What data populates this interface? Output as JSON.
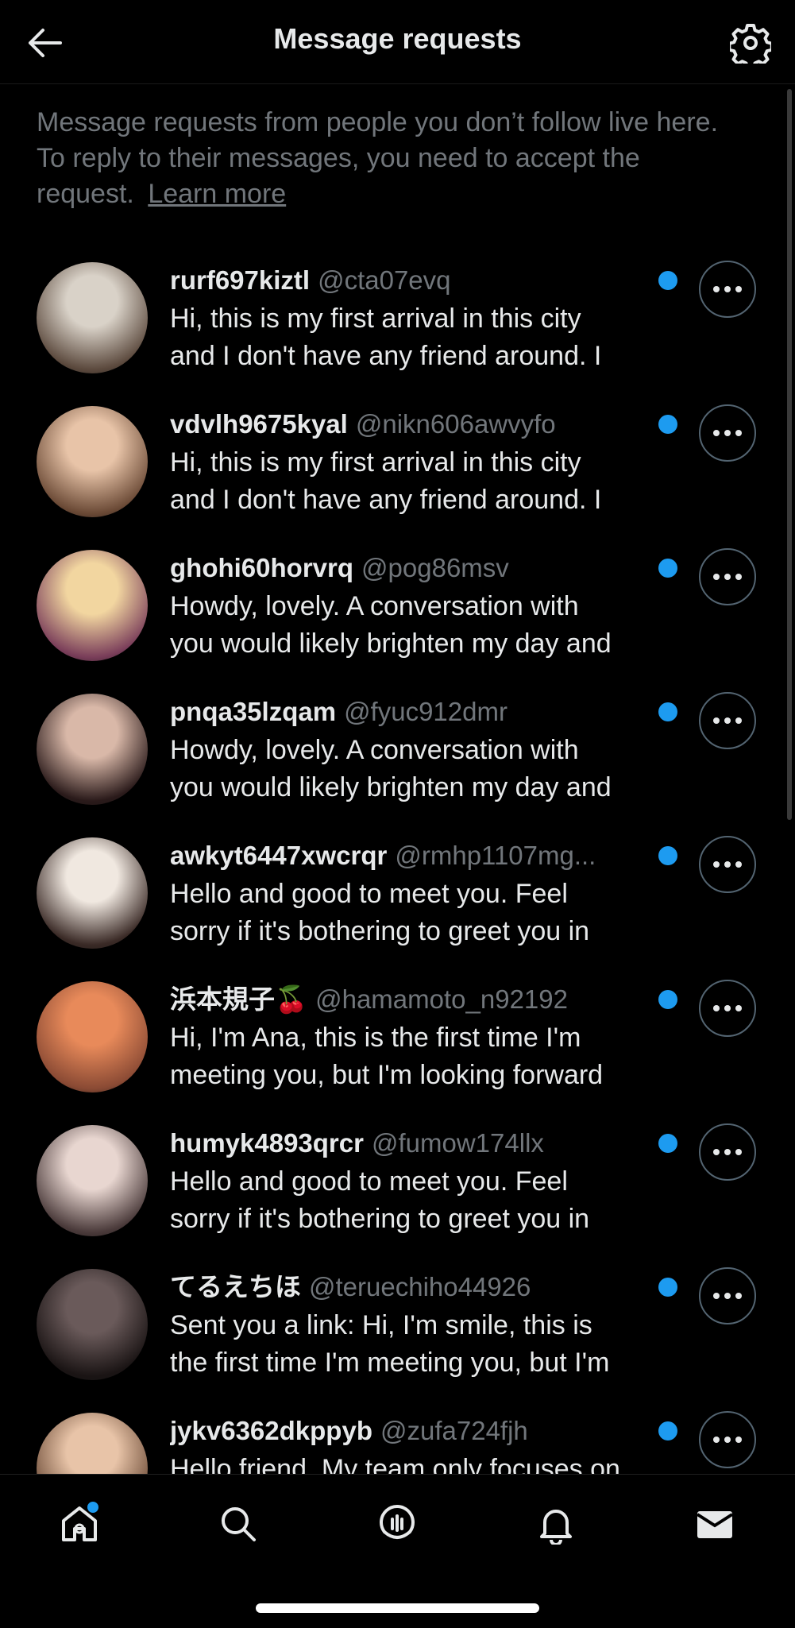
{
  "header": {
    "title": "Message requests",
    "back_icon": "arrow-left-icon",
    "settings_icon": "gear-icon"
  },
  "info": {
    "text": "Message requests from people you don’t follow live here. To reply to their messages, you need to accept the request.",
    "learn_more": "Learn more"
  },
  "requests": [
    {
      "name": "rurf697kiztl",
      "handle": "@cta07evq",
      "line1": "Hi, this is my first arrival in this city",
      "line2": "and I don't have any friend around. I",
      "avatar_colors": [
        "#d9d2c8",
        "#5c4a3e"
      ]
    },
    {
      "name": "vdvlh9675kyal",
      "handle": "@nikn606awvyfo",
      "line1": "Hi, this is my first arrival in this city",
      "line2": "and I don't have any friend around. I",
      "avatar_colors": [
        "#e8c4a8",
        "#6b4a36"
      ]
    },
    {
      "name": "ghohi60horvrq",
      "handle": "@pog86msv",
      "line1": "Howdy, lovely. A conversation with",
      "line2": "you would likely brighten my day and",
      "avatar_colors": [
        "#f2d6a0",
        "#7a3e5a"
      ]
    },
    {
      "name": "pnqa35lzqam",
      "handle": "@fyuc912dmr",
      "line1": "Howdy, lovely. A conversation with",
      "line2": "you would likely brighten my day and",
      "avatar_colors": [
        "#d9b8a8",
        "#2a1a1a"
      ]
    },
    {
      "name": "awkyt6447xwcrqr",
      "handle": "@rmhp1107mg...",
      "line1": "Hello and good to meet you. Feel",
      "line2": "sorry if it's bothering to greet you in",
      "avatar_colors": [
        "#f0e8e0",
        "#3a2a26"
      ]
    },
    {
      "name": "浜本規子🍒",
      "handle": "@hamamoto_n92192",
      "line1": "Hi, I'm Ana, this is the first time I'm",
      "line2": "meeting you, but I'm looking forward",
      "avatar_colors": [
        "#e88a5a",
        "#8a4a34"
      ]
    },
    {
      "name": "humyk4893qrcr",
      "handle": "@fumow174llx",
      "line1": "Hello and good to meet you. Feel",
      "line2": "sorry if it's bothering to greet you in",
      "avatar_colors": [
        "#e8d6d0",
        "#4a3a3a"
      ]
    },
    {
      "name": "てるえちほ",
      "handle": "@teruechiho44926",
      "line1": "Sent you a link: Hi, I'm smile, this is",
      "line2": "the first time I'm meeting you, but I'm",
      "avatar_colors": [
        "#6a5a5a",
        "#1a1414"
      ]
    },
    {
      "name": "jykv6362dkppyb",
      "handle": "@zufa724fjh",
      "line1": "Hello friend. My team only focuses on",
      "line2": "",
      "avatar_colors": [
        "#e8c4a8",
        "#6b4a36"
      ]
    }
  ],
  "nav": {
    "items": [
      "home-icon",
      "search-icon",
      "spaces-icon",
      "notifications-icon",
      "messages-icon"
    ]
  },
  "colors": {
    "accent": "#1d9bf0",
    "background": "#000000",
    "text_primary": "#e7e9ea",
    "text_secondary": "#71767b"
  }
}
